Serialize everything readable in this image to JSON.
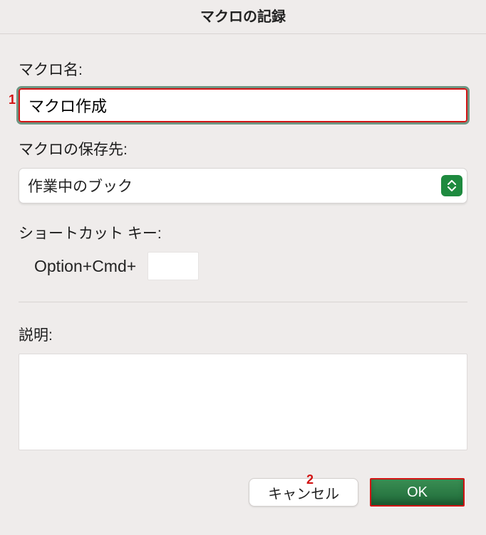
{
  "dialog": {
    "title": "マクロの記録"
  },
  "macro_name": {
    "label": "マクロ名:",
    "value": "マクロ作成"
  },
  "save_dest": {
    "label": "マクロの保存先:",
    "selected": "作業中のブック"
  },
  "shortcut": {
    "label": "ショートカット キー:",
    "prefix": "Option+Cmd+",
    "value": ""
  },
  "description": {
    "label": "説明:",
    "value": ""
  },
  "buttons": {
    "cancel": "キャンセル",
    "ok": "OK"
  },
  "annotations": {
    "a1": "1",
    "a2": "2"
  },
  "colors": {
    "accent_green": "#1e8a3f",
    "annotation_red": "#d21414"
  }
}
